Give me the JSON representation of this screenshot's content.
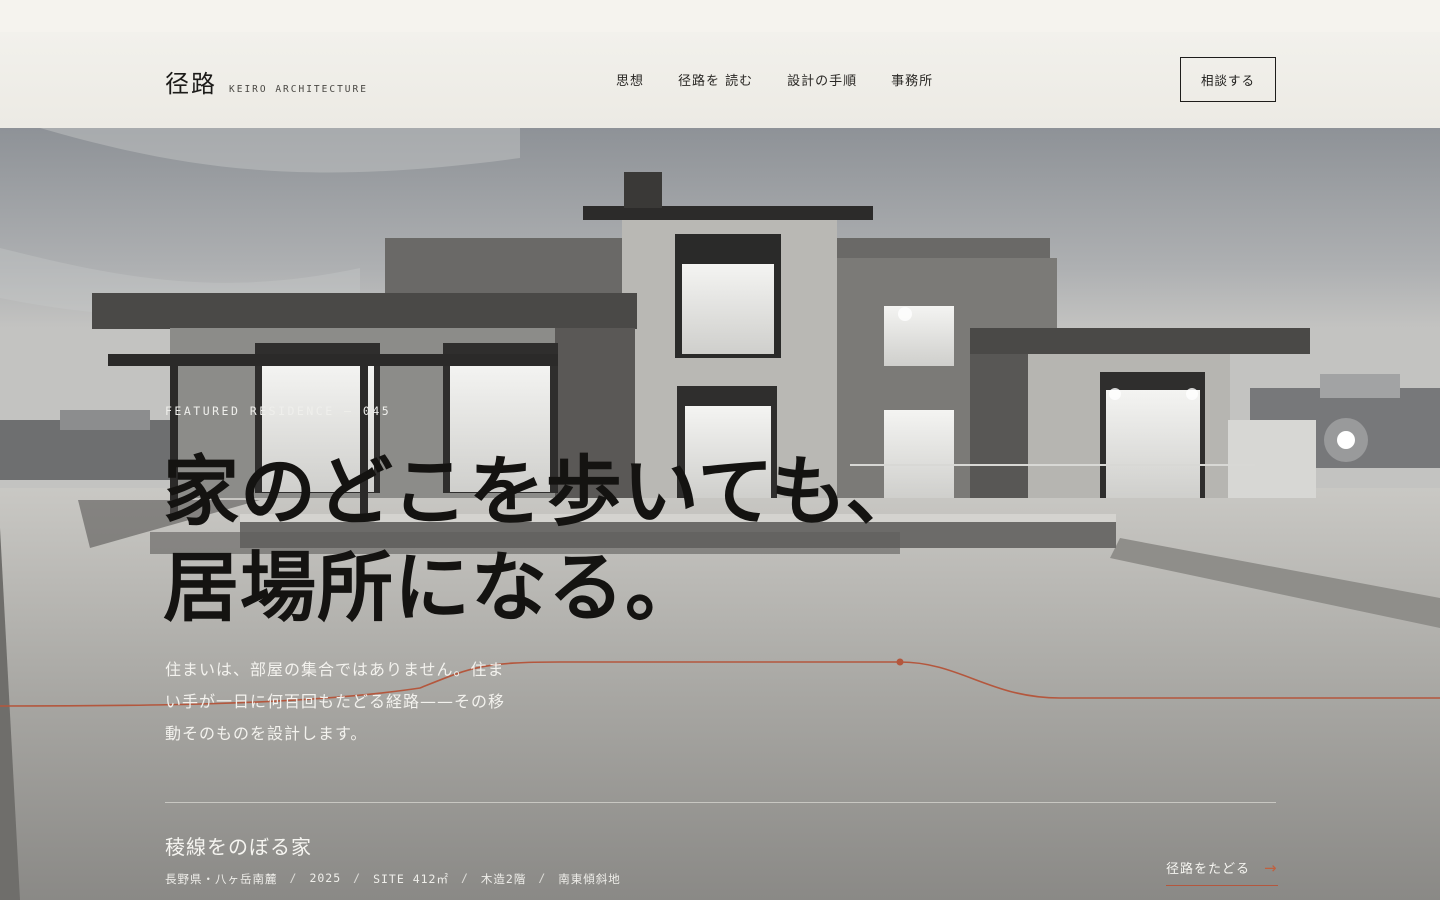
{
  "header": {
    "brand_mark": "径路",
    "brand_sub": "KEIRO ARCHITECTURE",
    "nav": [
      {
        "label": "思想"
      },
      {
        "label": "径路を 読む"
      },
      {
        "label": "設計の手順"
      },
      {
        "label": "事務所"
      }
    ],
    "cta_label": "相談する"
  },
  "hero": {
    "eyebrow": "FEATURED RESIDENCE — 045",
    "headline_line1": "家のどこを歩いても、",
    "headline_line2": "居場所になる。",
    "lede": "住まいは、部屋の集合ではありません。住まい手が一日に何百回もたどる経路——その移動そのものを設計します。",
    "project": {
      "name": "稜線をのぼる家",
      "meta": [
        "長野県・八ヶ岳南麓",
        "2025",
        "SITE 412㎡",
        "木造2階",
        "南東傾斜地"
      ]
    },
    "trace_link": {
      "label": "径路をたどる",
      "arrow": "→"
    }
  },
  "colors": {
    "accent": "#b4573d",
    "ink": "#141311",
    "paper": "#f2f1ec"
  },
  "icons": {
    "arrow": "arrow-right-icon"
  }
}
